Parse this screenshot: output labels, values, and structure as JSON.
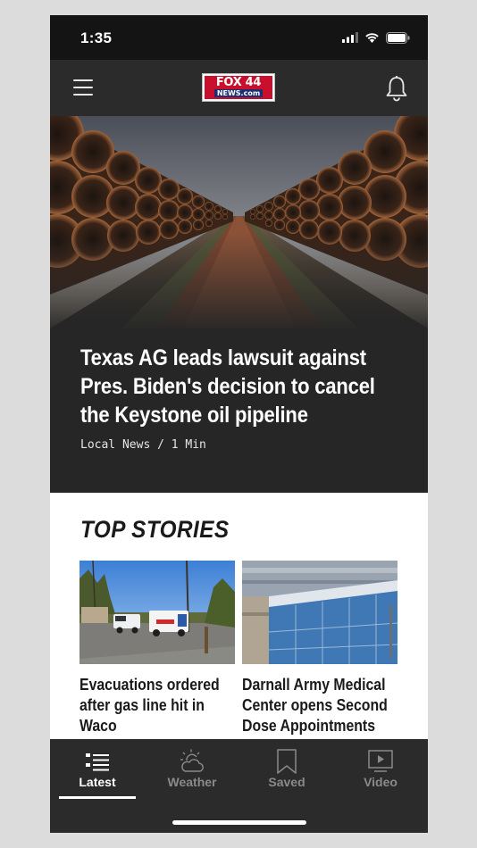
{
  "status_bar": {
    "time": "1:35"
  },
  "header": {
    "logo_top": "FOX 44",
    "logo_bottom": "NEWS.com",
    "menu_icon": "hamburger-menu-icon",
    "notification_icon": "bell-icon"
  },
  "hero": {
    "title": "Texas AG leads lawsuit against Pres. Biden's decision to cancel the Keystone oil pipeline",
    "meta": "Local News / 1 Min"
  },
  "top_stories": {
    "heading": "TOP STORIES",
    "items": [
      {
        "title": "Evacuations ordered after gas line hit in Waco"
      },
      {
        "title": "Darnall Army Medical Center opens Second Dose Appointments for"
      }
    ]
  },
  "tab_bar": {
    "tabs": [
      {
        "label": "Latest",
        "icon": "list-icon",
        "active": true
      },
      {
        "label": "Weather",
        "icon": "partly-cloudy-icon",
        "active": false
      },
      {
        "label": "Saved",
        "icon": "bookmark-icon",
        "active": false
      },
      {
        "label": "Video",
        "icon": "play-video-icon",
        "active": false
      }
    ]
  },
  "colors": {
    "brand_red": "#c8102e",
    "brand_blue": "#1d2f6f",
    "dark_bg": "#262626",
    "header_bg": "#2b2b2b"
  }
}
